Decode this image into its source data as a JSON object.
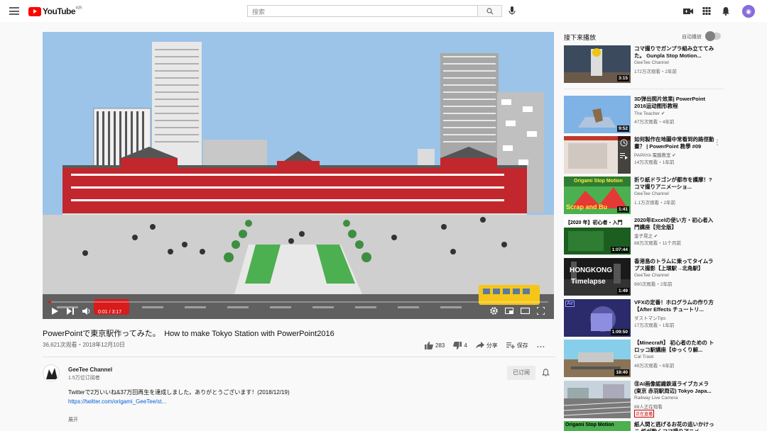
{
  "masthead": {
    "logo_text": "YouTube",
    "region": "KR",
    "search_placeholder": "搜索"
  },
  "player": {
    "current_time": "0:01 / 3:17",
    "progress_fraction": 0.005
  },
  "video": {
    "title": "PowerPointで東京駅作ってみた。　How to make Tokyo Station with PowerPoint2016",
    "views_date": "36,621次观看・2018年12月10日",
    "likes": "283",
    "dislikes": "4",
    "share_label": "分享",
    "save_label": "保存",
    "more_label": "..."
  },
  "channel": {
    "name": "GeeTee Channel",
    "subscribers": "1.5万位订阅者",
    "subscribe_label": "已订阅",
    "description_line": "Twitterで2万いいね&37万回再生を達成しました。ありがとうございます！(2018/12/19)",
    "link": "https://twitter.com/origami_GeeTee/st...",
    "expand_label": "展开"
  },
  "sidebar": {
    "up_next": "接下来播放",
    "autoplay": "自动播放",
    "items": [
      {
        "title": "コマ撮りでガンプラ組み立ててみた。 Gunpla Stop Motion...",
        "channel": "GeeTee Channel",
        "meta": "172万次观看・2年前",
        "duration": "3:15"
      },
      {
        "title": "3D弹出照片效果| PowerPoint 2016运动图形教程",
        "channel": "The Teacher ✔",
        "meta": "47万次观看・4年前",
        "duration": "9:52"
      },
      {
        "title": "如何製作在地圖中常看到的路徑動畫？ | PowerPoint 教學 #09",
        "channel": "PAPAYA 電腦教室 ✔",
        "meta": "14万次观看・1年前",
        "duration": ""
      },
      {
        "title": "折り紙ドラゴンが都市を護摩！? コマ撮りアニメーショ...",
        "channel": "GeeTee Channel",
        "meta": "1.1万次观看・2年前",
        "duration": "1:41"
      },
      {
        "title": "2020年Excelの使い方・初心者入門講座【完全版】",
        "channel": "金子晃之 ✔",
        "meta": "88万次观看・11个月前",
        "duration": "1:07:44"
      },
      {
        "title": "香港島のトラムに乗ってタイムラプス撮影【上環駅→北角駅】",
        "channel": "GeeTee Channel",
        "meta": "900次观看・2年前",
        "duration": "1:49"
      },
      {
        "title": "VFXの定番！ホログラムの作り方【After Effects チュートリ...",
        "channel": "ダストマンTips",
        "meta": "17万次观看・1年前",
        "duration": "1:09:50"
      },
      {
        "title": "【Minecraft】 初心者のための トロッコ駅講座【ゆっくり解...",
        "channel": "Cal Trask",
        "meta": "49万次观看・6年前",
        "duration": "18:40"
      },
      {
        "title": "㊟AI画像認識鉄道ライブカメラ (東京 赤羽駅周辺) Tokyo Japa...",
        "channel": "Railway Live Camera",
        "meta": "88人正在观看",
        "duration": "",
        "live": "正在直播"
      },
      {
        "title": "紙人間と逃げるお花の追いかけっこ 紙が動くコマ撮りアニメ",
        "channel": "",
        "meta": "",
        "duration": ""
      }
    ],
    "thumb_texts": {
      "t4": "Origami Stop Motion",
      "t4b": "Scrap and Bu",
      "t5": "【2020 年】初心者・入門",
      "t6": "HONGKONG",
      "t6b": "Timelapse",
      "t7": "Ae",
      "t10": "Origami Stop Motion"
    }
  }
}
